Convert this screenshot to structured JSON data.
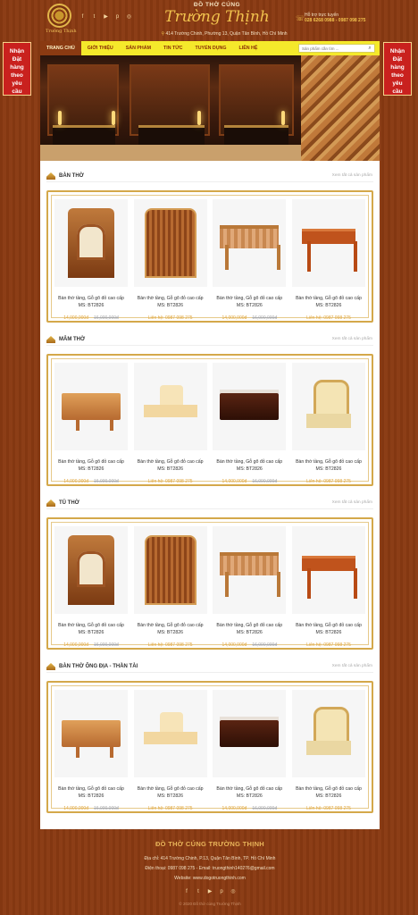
{
  "header": {
    "logo_text": "Trường Thịnh",
    "brand_small": "ĐỒ THỜ CÚNG",
    "brand_big": "Trường Thịnh",
    "address": "414 Trường Chinh, Phường 13, Quận Tân Bình, Hồ Chí Minh",
    "hotline_title": "Hỗ trợ trực tuyến",
    "hotline_numbers": "028 6268 0988 - 0987 098 275",
    "social_icons": [
      "facebook-icon",
      "twitter-icon",
      "youtube-icon",
      "pinterest-icon",
      "instagram-icon"
    ]
  },
  "nav": {
    "items": [
      "TRANG CHỦ",
      "GIỚI THIỆU",
      "SẢN PHẨM",
      "TIN TỨC",
      "TUYỂN DỤNG",
      "LIÊN HỆ"
    ],
    "search_placeholder": "Sản phẩm cần tìm ..."
  },
  "side_badges": {
    "left": "Nhận\nĐặt\nhàng\ntheo\nyêu\ncầu",
    "right": "Nhận\nĐặt\nhàng\ntheo\nyêu\ncầu"
  },
  "sections": [
    {
      "title": "BÀN THỜ",
      "more": "Xem tất cả sản phẩm",
      "products": [
        {
          "name": "Bàn thờ tầng, Gỗ gõ đỏ cao cấp",
          "code": "MS: BT2826",
          "price": "14,000,000đ",
          "old": "16,000,000đ",
          "contact": ""
        },
        {
          "name": "Bàn thờ tầng, Gỗ gõ đỏ cao cấp",
          "code": "MS: BT2826",
          "price": "",
          "old": "",
          "contact": "Liên hệ: 0987 098 275"
        },
        {
          "name": "Bàn thờ tầng, Gỗ gõ đỏ cao cấp",
          "code": "MS: BT2826",
          "price": "14,000,000đ",
          "old": "16,000,000đ",
          "contact": ""
        },
        {
          "name": "Bàn thờ tầng, Gỗ gõ đỏ cao cấp",
          "code": "MS: BT2826",
          "price": "",
          "old": "",
          "contact": "Liên hệ: 0987 098 275"
        }
      ]
    },
    {
      "title": "MÂM THỜ",
      "more": "Xem tất cả sản phẩm",
      "products": [
        {
          "name": "Bàn thờ tầng, Gỗ gõ đỏ cao cấp",
          "code": "MS: BT2826",
          "price": "14,000,000đ",
          "old": "16,000,000đ",
          "contact": ""
        },
        {
          "name": "Bàn thờ tầng, Gỗ gõ đỏ cao cấp",
          "code": "MS: BT2826",
          "price": "",
          "old": "",
          "contact": "Liên hệ: 0987 098 275"
        },
        {
          "name": "Bàn thờ tầng, Gỗ gõ đỏ cao cấp",
          "code": "MS: BT2826",
          "price": "14,000,000đ",
          "old": "16,000,000đ",
          "contact": ""
        },
        {
          "name": "Bàn thờ tầng, Gỗ gõ đỏ cao cấp",
          "code": "MS: BT2826",
          "price": "",
          "old": "",
          "contact": "Liên hệ: 0987 098 275"
        }
      ]
    },
    {
      "title": "TỦ THỜ",
      "more": "Xem tất cả sản phẩm",
      "products": [
        {
          "name": "Bàn thờ tầng, Gỗ gõ đỏ cao cấp",
          "code": "MS: BT2826",
          "price": "14,000,000đ",
          "old": "16,000,000đ",
          "contact": ""
        },
        {
          "name": "Bàn thờ tầng, Gỗ gõ đỏ cao cấp",
          "code": "MS: BT2826",
          "price": "",
          "old": "",
          "contact": "Liên hệ: 0987 098 275"
        },
        {
          "name": "Bàn thờ tầng, Gỗ gõ đỏ cao cấp",
          "code": "MS: BT2826",
          "price": "14,000,000đ",
          "old": "16,000,000đ",
          "contact": ""
        },
        {
          "name": "Bàn thờ tầng, Gỗ gõ đỏ cao cấp",
          "code": "MS: BT2826",
          "price": "",
          "old": "",
          "contact": "Liên hệ: 0987 098 275"
        }
      ]
    },
    {
      "title": "BÀN THỜ ÔNG ĐỊA - THẦN TÀI",
      "more": "Xem tất cả sản phẩm",
      "products": [
        {
          "name": "Bàn thờ tầng, Gỗ gõ đỏ cao cấp",
          "code": "MS: BT2826",
          "price": "14,000,000đ",
          "old": "16,000,000đ",
          "contact": ""
        },
        {
          "name": "Bàn thờ tầng, Gỗ gõ đỏ cao cấp",
          "code": "MS: BT2826",
          "price": "",
          "old": "",
          "contact": "Liên hệ: 0987 098 275"
        },
        {
          "name": "Bàn thờ tầng, Gỗ gõ đỏ cao cấp",
          "code": "MS: BT2826",
          "price": "14,000,000đ",
          "old": "16,000,000đ",
          "contact": ""
        },
        {
          "name": "Bàn thờ tầng, Gỗ gõ đỏ cao cấp",
          "code": "MS: BT2826",
          "price": "",
          "old": "",
          "contact": "Liên hệ: 0987 098 275"
        }
      ]
    }
  ],
  "footer": {
    "title": "ĐỒ THỜ CÚNG TRƯỜNG THỊNH",
    "address": "Địa chỉ: 414 Trường Chinh, P.13, Quận Tân Bình, TP. Hồ Chí Minh",
    "contact": "Điện thoại: 0987 098 275  -  Email: truongthinh140276@gmail.com",
    "website": "Website: www.dogotruongthinh.com",
    "copyright": "© 2020 Đồ thờ cúng Trường Thịnh"
  },
  "colors": {
    "brand_brown": "#8a3a12",
    "nav_yellow": "#f5e92b",
    "gold": "#e2b64a",
    "badge_red": "#c9211e"
  }
}
